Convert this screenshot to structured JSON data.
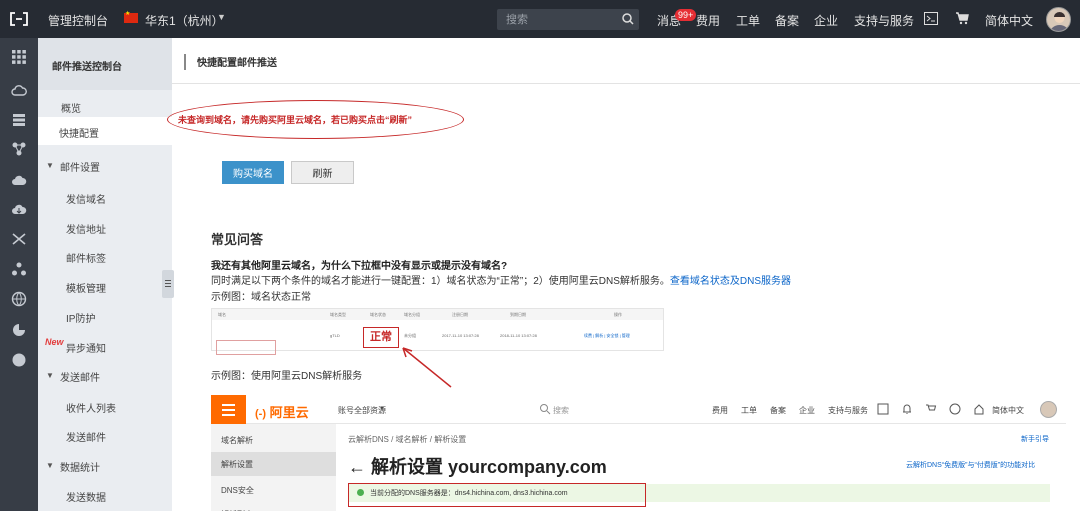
{
  "topbar": {
    "title": "管理控制台",
    "region": "华东1（杭州）",
    "search_placeholder": "搜索",
    "messages": "消息",
    "messages_badge": "99+",
    "billing": "费用",
    "tickets": "工单",
    "icp": "备案",
    "enterprise": "企业",
    "support": "支持与服务",
    "language": "简体中文"
  },
  "rail_icons": [
    "grid-icon",
    "cloud-icon",
    "list-icon",
    "nodes-icon",
    "cloud-upload-icon",
    "cloud-download-icon",
    "shuffle-icon",
    "cluster-icon",
    "globe-icon",
    "pie-icon",
    "circle-icon"
  ],
  "sidebar": {
    "header": "邮件推送控制台",
    "items": [
      {
        "label": "概览",
        "type": "item"
      },
      {
        "label": "快捷配置",
        "type": "item",
        "active": true
      },
      {
        "label": "邮件设置",
        "type": "group"
      },
      {
        "label": "发信域名",
        "type": "sub"
      },
      {
        "label": "发信地址",
        "type": "sub"
      },
      {
        "label": "邮件标签",
        "type": "sub"
      },
      {
        "label": "模板管理",
        "type": "sub"
      },
      {
        "label": "IP防护",
        "type": "sub"
      },
      {
        "label": "异步通知",
        "type": "sub",
        "new_tag": "New"
      },
      {
        "label": "发送邮件",
        "type": "group"
      },
      {
        "label": "收件人列表",
        "type": "sub"
      },
      {
        "label": "发送邮件",
        "type": "sub"
      },
      {
        "label": "数据统计",
        "type": "group"
      },
      {
        "label": "发送数据",
        "type": "sub"
      }
    ]
  },
  "main": {
    "title": "快捷配置邮件推送",
    "warning": "未查询到域名，请先购买阿里云域名，若已购买点击“刷新”",
    "buy_button": "购买域名",
    "refresh_button": "刷新",
    "faq_heading": "常见问答",
    "faq_question": "我还有其他阿里云域名，为什么下拉框中没有显示或提示没有域名?",
    "faq_answer": "同时满足以下两个条件的域名才能进行一键配置：1）域名状态为“正常”；2）使用阿里云DNS解析服务。",
    "faq_link": "查看域名状态及DNS服务器",
    "example1_label": "示例图：域名状态正常",
    "example1": {
      "headers": [
        "域名",
        "域名类型",
        "域名状态",
        "域名分组",
        "注册日期",
        "到期日期",
        "操作"
      ],
      "row": [
        "",
        "gTLD",
        "正常",
        "未分组",
        "2017-11-10 13:07:28",
        "2018-11-10 13:07:28",
        "续费 | 解析 | 安全锁 | 管理"
      ],
      "status_highlight": "正常"
    },
    "example2_label": "示例图：使用阿里云DNS解析服务",
    "example2": {
      "logo": "阿里云",
      "resources": "账号全部资源",
      "search": "搜索",
      "nav": [
        "费用",
        "工单",
        "备案",
        "企业",
        "支持与服务",
        "简体中文"
      ],
      "side_items": [
        "域名解析",
        "解析设置",
        "DNS安全",
        "解析列表"
      ],
      "active_side": "解析设置",
      "breadcrumb": "云解析DNS / 域名解析 / 解析设置",
      "help_link": "新手引导",
      "title": "解析设置 yourcompany.com",
      "compare_link": "云解析DNS“免费版”与“付费版”的功能对比",
      "notice": "当前分配的DNS服务器是：dns4.hichina.com, dns3.hichina.com"
    }
  }
}
